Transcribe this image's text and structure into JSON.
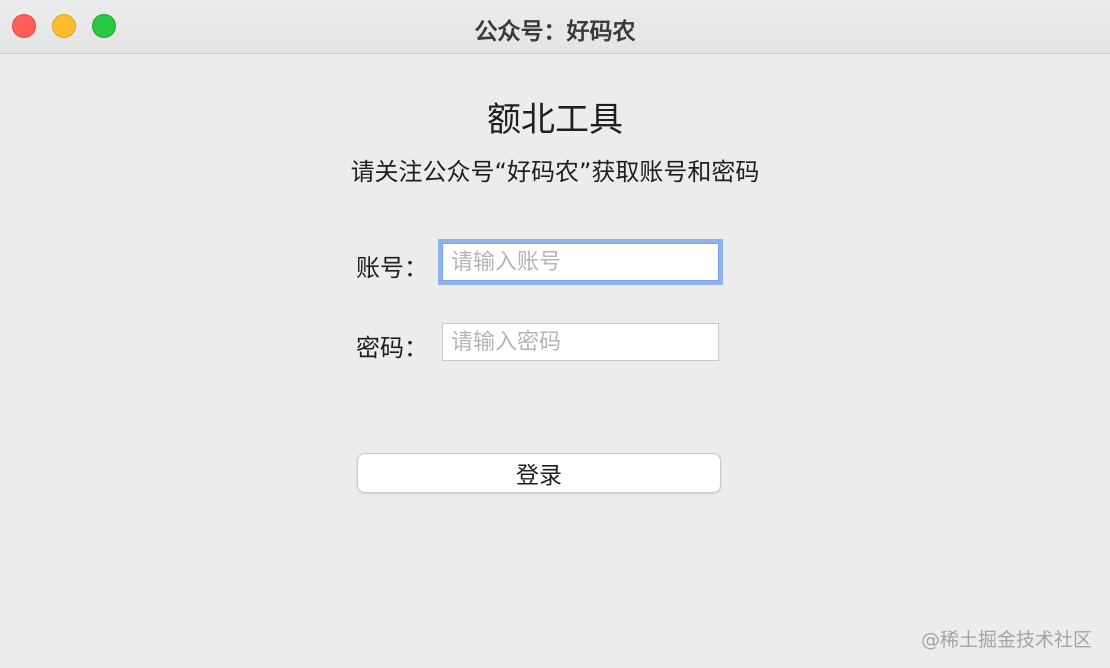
{
  "window": {
    "title": "公众号：好码农",
    "controls": {
      "close": "close-icon",
      "minimize": "minimize-icon",
      "maximize": "maximize-icon"
    }
  },
  "main": {
    "app_title": "额北工具",
    "subtitle": "请关注公众号“好码农”获取账号和密码"
  },
  "form": {
    "username_label": "账号：",
    "username_value": "",
    "username_placeholder": "请输入账号",
    "password_label": "密码：",
    "password_value": "",
    "password_placeholder": "请输入密码",
    "login_label": "登录"
  },
  "watermark": "@稀土掘金技术社区",
  "colors": {
    "close": "#ff5f57",
    "minimize": "#febc2e",
    "maximize": "#28c840",
    "focus_ring": "#8fb3ec"
  }
}
